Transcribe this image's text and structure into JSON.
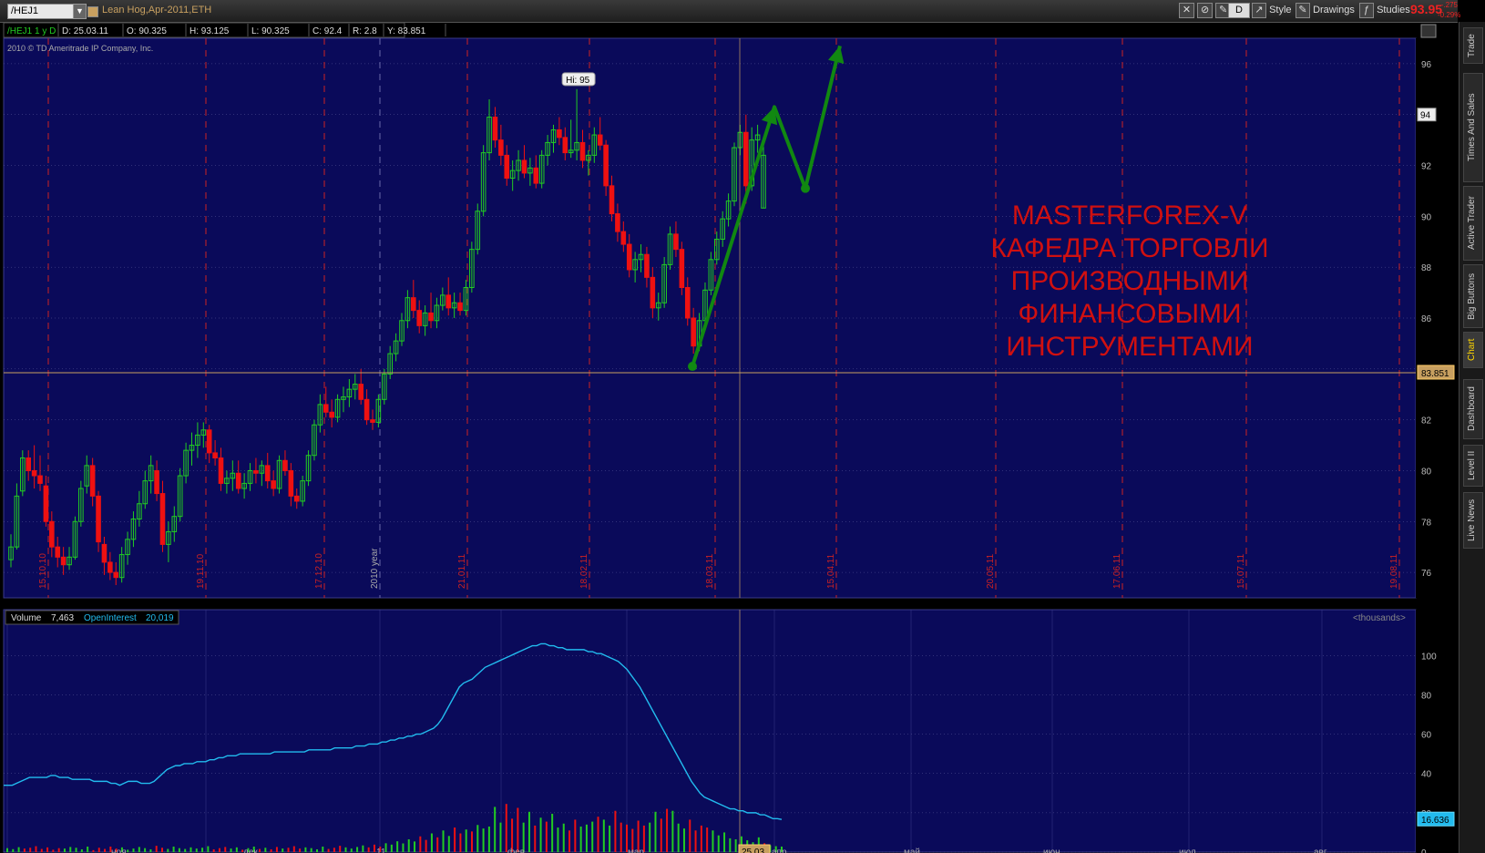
{
  "header": {
    "symbol": "/HEJ1",
    "instrument": "Lean Hog,Apr-2011,ETH",
    "last_price": "93.95",
    "change_abs": "-.275",
    "change_pct": "-0.29%",
    "btn_d": "D",
    "btn_style": "Style",
    "btn_drawings": "Drawings",
    "btn_studies": "Studies"
  },
  "infobar": {
    "label": "/HEJ1 1 y D",
    "date": "D: 25.03.11",
    "open": "O: 90.325",
    "high": "H: 93.125",
    "low": "L: 90.325",
    "close": "C: 92.4",
    "range": "R: 2.8",
    "y": "Y: 83.851"
  },
  "copyright": "2010 © TD Ameritrade IP Company, Inc.",
  "hi_label": "Hi: 95",
  "price_badge": "94",
  "cursor_badge": "83.851",
  "volume_bar": {
    "volume_label": "Volume",
    "volume_value": "7,463",
    "oi_label": "OpenInterest",
    "oi_value": "20,019",
    "units": "<thousands>"
  },
  "oi_badge": "16.636",
  "date_badge": "25.03",
  "annotation_lines": [
    "MASTERFOREX-V",
    "КАФЕДРА ТОРГОВЛИ",
    "ПРОИЗВОДНЫМИ",
    "ФИНАНСОВЫМИ",
    "ИНСТРУМЕНТАМИ"
  ],
  "sidebar_tabs": [
    "Trade",
    "Times And Sales",
    "Active Trader",
    "Big Buttons",
    "Chart",
    "Dashboard",
    "Level II",
    "Live News"
  ],
  "colors": {
    "bg": "#0a0a5a",
    "up": "#22cc22",
    "down": "#ee1111",
    "grid": "#5a5a9a",
    "expiry": "#cc2222",
    "oi": "#22bbee",
    "arrow": "#118811"
  },
  "chart_data": {
    "type": "candlestick",
    "ylim": [
      75,
      97
    ],
    "yticks": [
      76,
      78,
      80,
      82,
      84,
      86,
      88,
      90,
      92,
      94,
      96
    ],
    "vol_ylim": [
      0,
      115
    ],
    "vol_yticks": [
      0,
      20,
      40,
      60,
      80,
      100
    ],
    "expiry_labels": [
      "15.10.10",
      "19.11.10",
      "17.12.10",
      "2010 year",
      "21.01.11",
      "18.02.11",
      "18.03.11",
      "15.04.11",
      "20.05.11",
      "17.06.11",
      "15.07.11",
      "19.08.11"
    ],
    "month_labels": [
      "ноя",
      "дек",
      "11",
      "фев",
      "мар",
      "25.03",
      "апр",
      "май",
      "июн",
      "июл",
      "авг"
    ],
    "candles": [
      [
        76.5,
        77.5,
        76.2,
        77.0
      ],
      [
        77.0,
        79.5,
        76.9,
        79.0
      ],
      [
        79.2,
        80.8,
        79.0,
        80.5
      ],
      [
        80.5,
        80.8,
        79.6,
        80.0
      ],
      [
        80.0,
        81.0,
        79.3,
        79.8
      ],
      [
        79.8,
        80.6,
        79.2,
        79.5
      ],
      [
        79.4,
        79.8,
        77.8,
        78.0
      ],
      [
        78.0,
        78.4,
        76.6,
        77.0
      ],
      [
        77.0,
        77.4,
        76.2,
        76.6
      ],
      [
        76.6,
        77.0,
        75.9,
        76.3
      ],
      [
        76.3,
        77.0,
        76.1,
        76.6
      ],
      [
        76.6,
        78.2,
        76.5,
        78.0
      ],
      [
        78.0,
        79.6,
        77.8,
        79.3
      ],
      [
        79.4,
        80.6,
        79.1,
        80.2
      ],
      [
        80.2,
        80.5,
        78.6,
        79.0
      ],
      [
        79.0,
        79.2,
        76.8,
        77.2
      ],
      [
        77.1,
        77.4,
        75.9,
        76.4
      ],
      [
        76.4,
        76.8,
        75.7,
        76.0
      ],
      [
        76.0,
        76.4,
        75.5,
        75.8
      ],
      [
        75.8,
        77.0,
        75.6,
        76.7
      ],
      [
        76.7,
        77.6,
        76.3,
        77.3
      ],
      [
        77.3,
        78.4,
        77.0,
        78.1
      ],
      [
        78.1,
        79.2,
        77.8,
        78.7
      ],
      [
        78.7,
        80.0,
        78.5,
        79.6
      ],
      [
        79.6,
        80.6,
        79.1,
        80.2
      ],
      [
        80.0,
        80.4,
        78.8,
        79.1
      ],
      [
        79.1,
        79.6,
        76.8,
        77.1
      ],
      [
        77.1,
        78.0,
        76.4,
        77.6
      ],
      [
        77.6,
        78.6,
        77.2,
        78.2
      ],
      [
        78.2,
        80.1,
        78.0,
        79.8
      ],
      [
        79.8,
        81.1,
        79.5,
        80.8
      ],
      [
        80.8,
        81.5,
        80.2,
        81.0
      ],
      [
        81.0,
        81.9,
        80.5,
        81.4
      ],
      [
        81.4,
        81.9,
        80.9,
        81.6
      ],
      [
        81.6,
        81.8,
        80.3,
        80.7
      ],
      [
        80.7,
        81.2,
        80.2,
        80.5
      ],
      [
        80.5,
        80.9,
        79.2,
        79.5
      ],
      [
        79.5,
        80.0,
        79.1,
        79.7
      ],
      [
        79.7,
        80.4,
        79.2,
        79.9
      ],
      [
        79.9,
        80.4,
        79.1,
        79.3
      ],
      [
        79.3,
        79.9,
        78.9,
        79.5
      ],
      [
        79.5,
        80.3,
        79.2,
        80.0
      ],
      [
        80.0,
        80.5,
        79.5,
        79.9
      ],
      [
        79.9,
        80.4,
        79.4,
        80.2
      ],
      [
        80.2,
        80.7,
        79.3,
        79.6
      ],
      [
        79.6,
        80.0,
        79.0,
        79.3
      ],
      [
        79.3,
        80.6,
        79.1,
        80.4
      ],
      [
        80.4,
        80.8,
        79.8,
        80.0
      ],
      [
        80.0,
        80.3,
        78.6,
        79.0
      ],
      [
        79.0,
        79.3,
        78.5,
        78.8
      ],
      [
        78.8,
        79.8,
        78.6,
        79.6
      ],
      [
        79.6,
        80.8,
        79.4,
        80.6
      ],
      [
        80.6,
        82.0,
        80.4,
        81.8
      ],
      [
        81.8,
        83.0,
        81.5,
        82.6
      ],
      [
        82.6,
        83.3,
        82.1,
        82.3
      ],
      [
        82.3,
        82.8,
        81.7,
        82.1
      ],
      [
        82.1,
        83.0,
        81.9,
        82.8
      ],
      [
        82.8,
        83.3,
        82.3,
        82.9
      ],
      [
        82.9,
        83.6,
        82.5,
        83.2
      ],
      [
        83.2,
        83.8,
        82.8,
        83.4
      ],
      [
        83.4,
        84.0,
        82.6,
        82.8
      ],
      [
        82.8,
        83.2,
        81.8,
        82.0
      ],
      [
        82.0,
        82.4,
        81.6,
        81.9
      ],
      [
        81.9,
        83.0,
        81.7,
        82.8
      ],
      [
        82.8,
        84.0,
        82.6,
        83.8
      ],
      [
        83.8,
        84.9,
        83.6,
        84.6
      ],
      [
        84.6,
        85.4,
        84.3,
        85.1
      ],
      [
        85.1,
        86.2,
        84.9,
        85.9
      ],
      [
        85.9,
        87.1,
        85.6,
        86.8
      ],
      [
        86.8,
        87.5,
        86.0,
        86.3
      ],
      [
        86.3,
        86.7,
        85.4,
        85.7
      ],
      [
        85.7,
        86.5,
        85.3,
        86.2
      ],
      [
        86.2,
        87.0,
        85.6,
        85.9
      ],
      [
        85.9,
        86.8,
        85.6,
        86.5
      ],
      [
        86.5,
        87.2,
        86.3,
        86.9
      ],
      [
        86.9,
        87.6,
        86.1,
        86.4
      ],
      [
        86.4,
        87.0,
        86.0,
        86.6
      ],
      [
        86.6,
        87.0,
        86.1,
        86.3
      ],
      [
        86.3,
        87.5,
        86.1,
        87.2
      ],
      [
        87.2,
        89.0,
        87.0,
        88.7
      ],
      [
        88.7,
        90.5,
        88.5,
        90.2
      ],
      [
        90.2,
        92.8,
        90.0,
        92.5
      ],
      [
        92.5,
        94.6,
        92.2,
        93.9
      ],
      [
        93.9,
        94.3,
        92.7,
        93.0
      ],
      [
        93.0,
        93.6,
        92.0,
        92.4
      ],
      [
        92.4,
        92.8,
        91.2,
        91.5
      ],
      [
        91.5,
        92.2,
        91.0,
        91.8
      ],
      [
        91.8,
        92.6,
        91.4,
        92.2
      ],
      [
        92.2,
        92.8,
        91.5,
        91.7
      ],
      [
        91.7,
        92.3,
        91.2,
        91.9
      ],
      [
        91.9,
        92.4,
        91.1,
        91.3
      ],
      [
        91.3,
        92.6,
        91.1,
        92.4
      ],
      [
        92.4,
        93.2,
        92.0,
        92.9
      ],
      [
        92.9,
        93.6,
        92.5,
        93.4
      ],
      [
        93.4,
        93.9,
        92.8,
        93.1
      ],
      [
        93.1,
        93.5,
        92.2,
        92.5
      ],
      [
        92.5,
        93.8,
        92.3,
        92.6
      ],
      [
        92.6,
        95.0,
        92.2,
        92.9
      ],
      [
        92.9,
        93.4,
        91.9,
        92.2
      ],
      [
        92.2,
        92.6,
        91.6,
        92.4
      ],
      [
        92.4,
        93.5,
        92.1,
        93.2
      ],
      [
        93.2,
        93.9,
        92.6,
        92.8
      ],
      [
        92.8,
        93.0,
        90.8,
        91.2
      ],
      [
        91.2,
        91.6,
        89.8,
        90.1
      ],
      [
        90.1,
        90.5,
        89.0,
        89.4
      ],
      [
        89.4,
        89.8,
        88.6,
        88.9
      ],
      [
        88.9,
        89.3,
        87.6,
        87.9
      ],
      [
        87.9,
        88.6,
        87.4,
        88.3
      ],
      [
        88.3,
        88.9,
        87.8,
        88.5
      ],
      [
        88.5,
        88.8,
        87.2,
        87.6
      ],
      [
        87.6,
        88.0,
        86.0,
        86.4
      ],
      [
        86.4,
        87.0,
        85.9,
        86.6
      ],
      [
        86.6,
        88.4,
        86.4,
        88.1
      ],
      [
        88.1,
        89.6,
        87.9,
        89.3
      ],
      [
        89.3,
        89.8,
        88.4,
        88.7
      ],
      [
        88.7,
        89.0,
        86.9,
        87.2
      ],
      [
        87.2,
        87.6,
        85.7,
        86.0
      ],
      [
        86.0,
        86.4,
        84.6,
        84.9
      ],
      [
        84.9,
        86.2,
        84.7,
        85.9
      ],
      [
        85.9,
        87.4,
        85.6,
        87.1
      ],
      [
        87.1,
        88.6,
        86.9,
        88.3
      ],
      [
        88.3,
        89.4,
        88.1,
        89.1
      ],
      [
        89.1,
        90.2,
        88.8,
        89.9
      ],
      [
        89.9,
        90.9,
        89.6,
        90.6
      ],
      [
        90.6,
        92.9,
        90.4,
        92.7
      ],
      [
        92.7,
        93.6,
        92.4,
        93.3
      ],
      [
        93.3,
        94.0,
        90.5,
        91.2
      ],
      [
        91.2,
        93.5,
        91.0,
        93.0
      ],
      [
        93.0,
        93.6,
        92.5,
        93.2
      ],
      [
        90.325,
        93.125,
        90.325,
        92.4
      ]
    ],
    "volume": [
      2.0,
      1.5,
      2.5,
      1.8,
      2.2,
      3.0,
      1.6,
      2.4,
      1.2,
      2.0,
      1.8,
      2.6,
      2.2,
      1.4,
      2.8,
      1.0,
      2.2,
      1.6,
      2.8,
      1.8,
      2.4,
      1.2,
      1.8,
      2.6,
      2.0,
      1.4,
      3.2,
      2.2,
      1.6,
      2.8,
      2.0,
      1.6,
      2.4,
      1.8,
      2.2,
      3.0,
      1.4,
      2.0,
      2.6,
      1.8,
      2.4,
      1.2,
      2.0,
      2.8,
      1.6,
      2.2,
      1.4,
      2.6,
      1.8,
      2.2,
      3.0,
      1.8,
      2.4,
      2.0,
      1.4,
      2.8,
      1.6,
      2.2,
      3.2,
      2.4,
      1.8,
      2.6,
      3.4,
      2.4,
      3.8,
      2.8,
      4.5,
      3.8,
      5.5,
      4.4,
      6.5,
      5.4,
      8.0,
      6.2,
      9.5,
      7.5,
      11.0,
      8.2,
      12.5,
      9.5,
      11.5,
      10.5,
      13.8,
      12.0,
      13.0,
      23.0,
      15.0,
      24.5,
      17.0,
      22.5,
      15.0,
      20.5,
      13.5,
      17.5,
      15.5,
      19.5,
      12.5,
      14.5,
      11.0,
      16.5,
      13.0,
      14.0,
      15.5,
      18.0,
      16.5,
      13.5,
      21.0,
      15.0,
      14.0,
      11.8,
      16.0,
      13.5,
      15.0,
      20.5,
      17.0,
      22.0,
      21.0,
      14.5,
      12.0,
      16.5,
      11.0,
      13.5,
      12.5,
      11.0,
      8.5,
      10.0,
      7.0,
      6.5,
      8.0,
      6.0,
      5.0,
      7.5,
      4.5,
      3.5,
      3.0,
      2.8
    ],
    "oi": [
      34,
      34,
      34,
      35,
      36,
      37,
      38,
      38,
      38,
      38,
      38,
      39,
      39,
      38,
      38,
      38,
      37,
      37,
      37,
      37,
      37,
      36,
      36,
      36,
      36,
      35,
      35,
      34,
      35,
      36,
      36,
      36,
      35,
      35,
      35,
      36,
      38,
      40,
      42,
      43,
      44,
      44,
      45,
      45,
      45,
      46,
      46,
      46,
      47,
      47,
      48,
      48,
      49,
      49,
      49,
      50,
      50,
      50,
      50,
      50,
      50,
      50,
      50,
      51,
      51,
      51,
      51,
      51,
      51,
      51,
      51,
      52,
      52,
      52,
      52,
      52,
      52,
      53,
      53,
      53,
      53,
      53,
      54,
      54,
      54,
      55,
      55,
      55,
      56,
      56,
      57,
      57,
      58,
      58,
      59,
      59,
      60,
      60,
      61,
      62,
      63,
      65,
      68,
      72,
      76,
      80,
      84,
      86,
      87,
      88,
      90,
      92,
      94,
      95,
      96,
      97,
      98,
      99,
      100,
      101,
      102,
      103,
      104,
      105,
      105,
      106,
      106,
      105,
      105,
      104,
      104,
      103,
      103,
      103,
      103,
      103,
      102,
      102,
      101,
      101,
      100,
      99,
      98,
      97,
      95,
      93,
      90,
      87,
      84,
      80,
      76,
      72,
      68,
      64,
      60,
      56,
      52,
      48,
      44,
      40,
      36,
      33,
      30,
      28,
      27,
      26,
      25,
      24,
      23,
      22,
      22,
      21,
      21,
      20,
      20,
      20,
      19,
      19,
      18,
      17,
      17,
      16.6
    ]
  }
}
